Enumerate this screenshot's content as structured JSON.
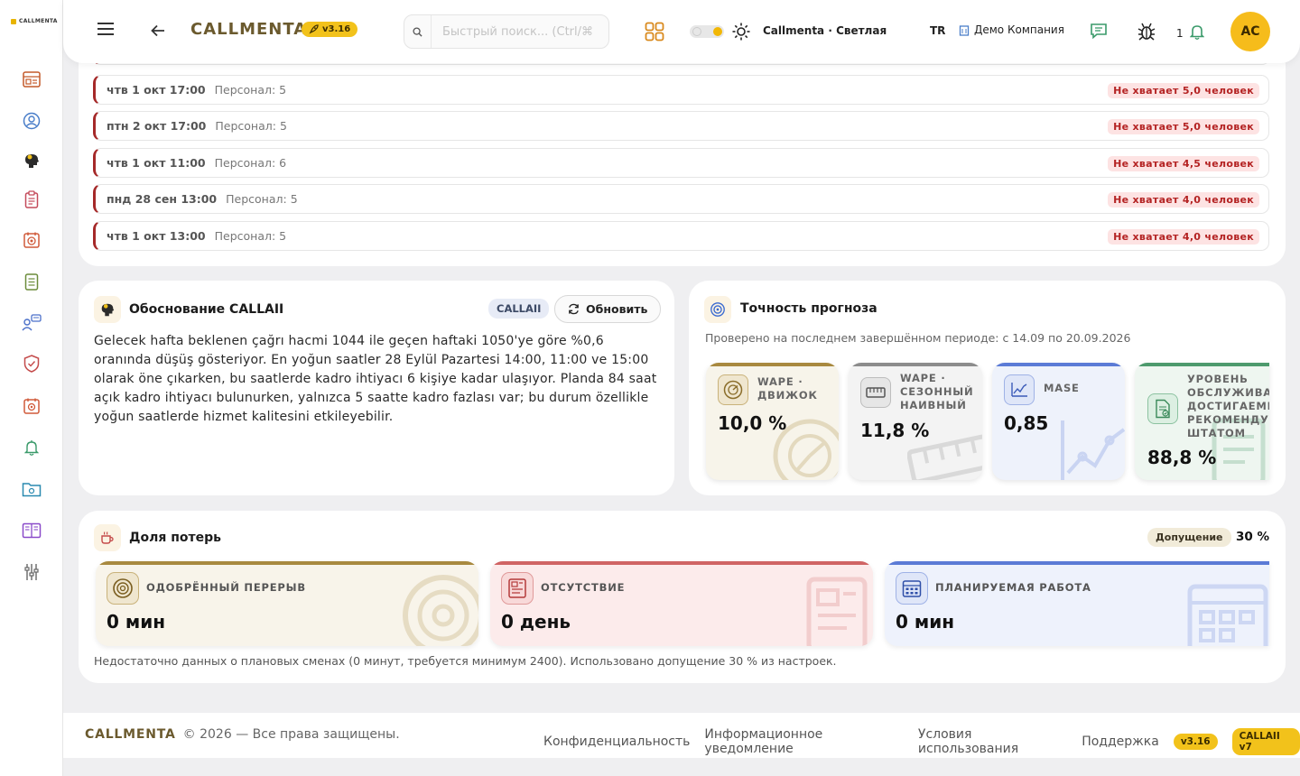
{
  "brand": {
    "name": "CALLMENTA",
    "sidebar_logo": "CALLMENTA"
  },
  "header": {
    "logo": "CALLMENTA",
    "version": "v3.16",
    "search_placeholder": "Быстрый поиск... (Ctrl/⌘",
    "theme_label": "Callmenta · Светлая",
    "language": "TR",
    "company": "Демо Компания",
    "notification_count": "1",
    "avatar_initials": "AC"
  },
  "sidebar": {
    "items": [
      {
        "icon": "dashboard-icon"
      },
      {
        "icon": "user-circle-icon"
      },
      {
        "icon": "ai-head-icon"
      },
      {
        "icon": "clipboard-icon"
      },
      {
        "icon": "target-icon"
      },
      {
        "icon": "checklist-icon"
      },
      {
        "icon": "team-chat-icon"
      },
      {
        "icon": "shield-icon"
      },
      {
        "icon": "calendar-target-icon"
      },
      {
        "icon": "bell-icon"
      },
      {
        "icon": "folder-icon"
      },
      {
        "icon": "book-icon"
      },
      {
        "icon": "sliders-icon"
      }
    ]
  },
  "shifts": [
    {
      "date": "чтв 1 окт 17:00",
      "staff": "Персонал: 5",
      "shortage": "Не хватает 5,0 человек"
    },
    {
      "date": "птн 2 окт 17:00",
      "staff": "Персонал: 5",
      "shortage": "Не хватает 5,0 человек"
    },
    {
      "date": "чтв 1 окт 11:00",
      "staff": "Персонал: 6",
      "shortage": "Не хватает 4,5 человек"
    },
    {
      "date": "пнд 28 сен 13:00",
      "staff": "Персонал: 5",
      "shortage": "Не хватает 4,0 человек"
    },
    {
      "date": "чтв 1 окт 13:00",
      "staff": "Персонал: 5",
      "shortage": "Не хватает 4,0 человек"
    }
  ],
  "rationale": {
    "title": "Обоснование CALLAII",
    "tag": "CALLAII",
    "refresh_label": "Обновить",
    "text": "Gelecek hafta beklenen çağrı hacmi 1044 ile geçen haftaki 1050'ye göre %0,6 oranında düşüş gösteriyor. En yoğun saatler 28 Eylül Pazartesi 14:00, 11:00 ve 15:00 olarak öne çıkarken, bu saatlerde kadro ihtiyacı 6 kişiye kadar ulaşıyor. Planda 84 saat açık kadro ihtiyacı bulunurken, yalnızca 5 saatte kadro fazlası var; bu durum özellikle yoğun saatlerde hizmet kalitesini etkileyebilir."
  },
  "accuracy": {
    "title": "Точность прогноза",
    "subtitle": "Проверено на последнем завершённом периоде: с 14.09 по 20.09.2026",
    "metrics": [
      {
        "label": "WAPE · ДВИЖОК",
        "value": "10,0 %",
        "icon": "gauge-icon",
        "color": "#a8893f"
      },
      {
        "label": "WAPE · СЕЗОННЫЙ НАИВНЫЙ",
        "value": "11,8 %",
        "icon": "ruler-icon",
        "color": "#8c8c8c"
      },
      {
        "label": "MASE",
        "value": "0,85",
        "icon": "chart-icon",
        "color": "#5b7bd6"
      },
      {
        "label": "УРОВЕНЬ ОБСЛУЖИВАНИЯ ДОСТИГАЕМЫЙ РЕКОМЕНДУЕМЫМ ШТАТОМ",
        "value": "88,8 %",
        "icon": "document-check-icon",
        "color": "#4d9a6d"
      }
    ]
  },
  "loss": {
    "title": "Доля потерь",
    "assumption_label": "Допущение",
    "assumption_value": "30 %",
    "items": [
      {
        "label": "ОДОБРЁННЫЙ ПЕРЕРЫВ",
        "value": "0 мин",
        "icon": "break-icon",
        "color": "#a8893f"
      },
      {
        "label": "ОТСУТСТВИЕ",
        "value": "0 день",
        "icon": "absence-icon",
        "color": "#d06464"
      },
      {
        "label": "ПЛАНИРУЕМАЯ РАБОТА",
        "value": "0 мин",
        "icon": "calendar-icon",
        "color": "#5b7bd6"
      }
    ],
    "note": "Недостаточно данных о плановых сменах (0 минут, требуется минимум 2400). Использовано допущение 30 % из настроек."
  },
  "footer": {
    "brand": "CALLMENTA",
    "copyright": "© 2026 — Все права защищены.",
    "links": [
      "Конфиденциальность",
      "Информационное уведомление",
      "Условия использования",
      "Поддержка"
    ],
    "version": "v3.16",
    "ai_version": "CALLAII v7"
  }
}
